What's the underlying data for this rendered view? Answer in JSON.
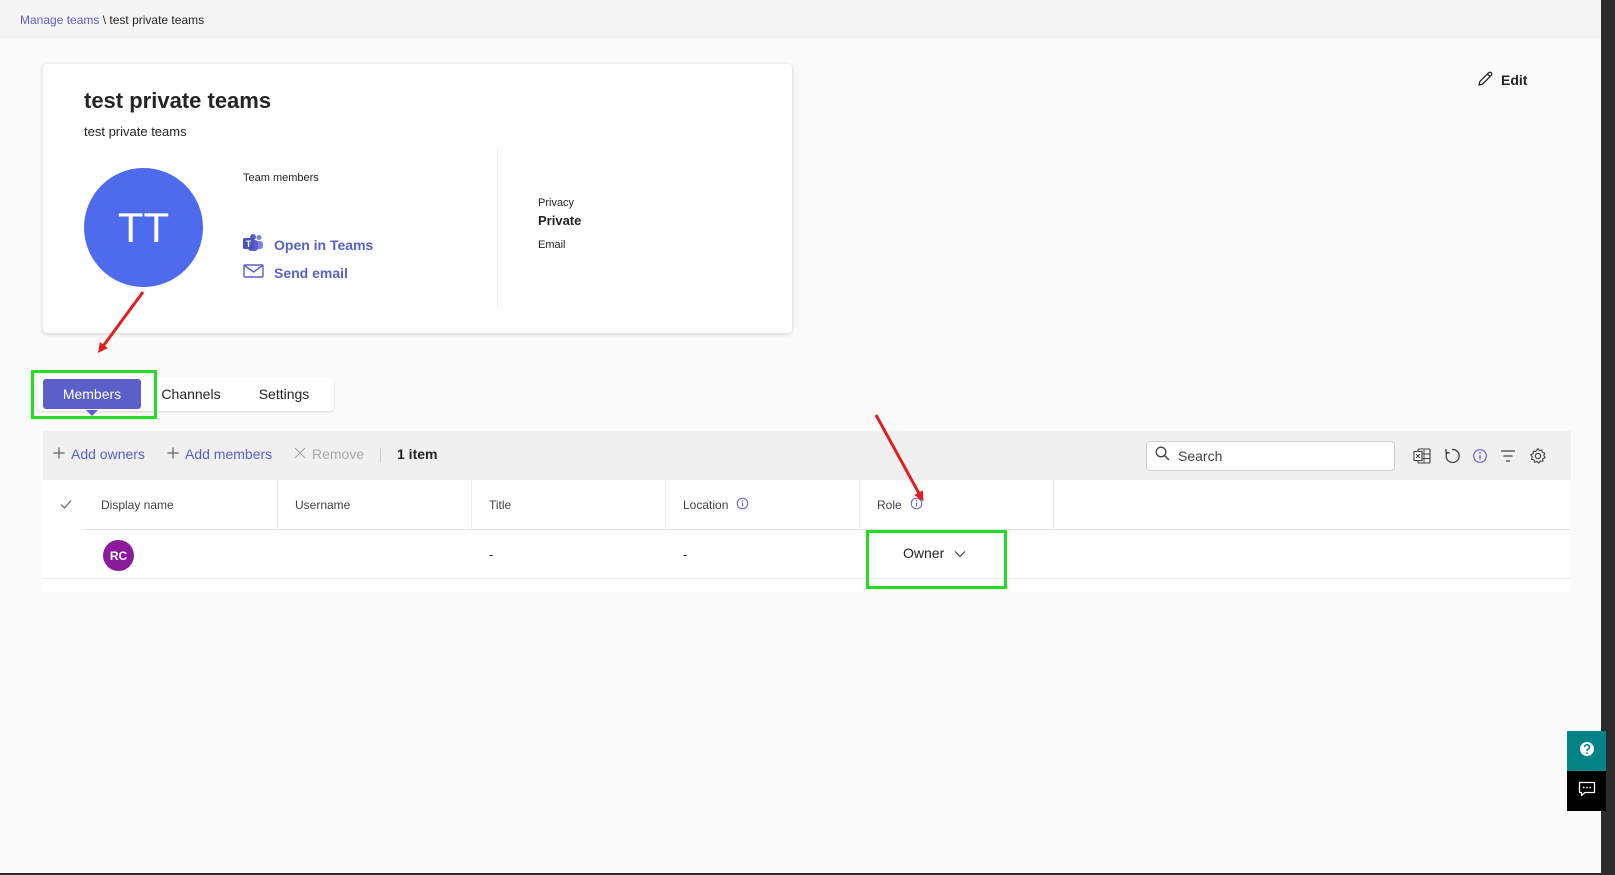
{
  "breadcrumb": {
    "parent": "Manage teams",
    "separator": " \\ ",
    "current": "test private teams"
  },
  "team": {
    "name": "test private teams",
    "description": "test private teams",
    "initials": "TT",
    "avatar_color": "#4f6bed",
    "members_label": "Team members",
    "open_in_teams_label": "Open in Teams",
    "send_email_label": "Send email",
    "privacy_label": "Privacy",
    "privacy_value": "Private",
    "email_label": "Email"
  },
  "edit_label": "Edit",
  "tabs": [
    {
      "label": "Members",
      "active": true
    },
    {
      "label": "Channels",
      "active": false
    },
    {
      "label": "Settings",
      "active": false
    }
  ],
  "toolbar": {
    "add_owners": "Add owners",
    "add_members": "Add members",
    "remove": "Remove",
    "item_count": "1 item",
    "search_placeholder": "Search",
    "icons": [
      "excel-export-icon",
      "refresh-icon",
      "info-icon",
      "filter-icon",
      "settings-icon"
    ]
  },
  "table": {
    "columns": [
      "Display name",
      "Username",
      "Title",
      "Location",
      "Role"
    ],
    "rows": [
      {
        "initials": "RC",
        "avatar_color": "#8c1a9c",
        "display_name": "",
        "username": "",
        "title": "-",
        "location": "-",
        "role": "Owner"
      }
    ]
  },
  "colors": {
    "accent": "#5b5fc7",
    "highlight": "#22dd22",
    "annotation_arrow": "#e02020",
    "help_button": "#038387"
  }
}
